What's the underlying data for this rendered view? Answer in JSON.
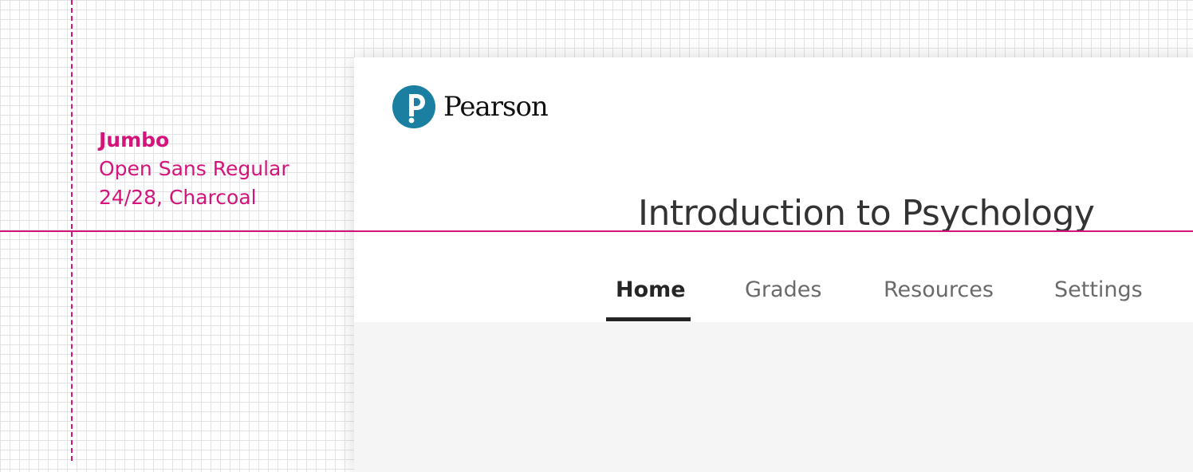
{
  "annotation": {
    "title": "Jumbo",
    "font_line": "Open Sans Regular",
    "spec_line": "24/28, Charcoal"
  },
  "brand": {
    "name": "Pearson",
    "logo_icon": "pearson-p-icon",
    "logo_color": "#1a7fa0"
  },
  "course": {
    "title": "Introduction to Psychology"
  },
  "tabs": [
    {
      "label": "Home",
      "active": true
    },
    {
      "label": "Grades",
      "active": false
    },
    {
      "label": "Resources",
      "active": false
    },
    {
      "label": "Settings",
      "active": false
    }
  ],
  "colors": {
    "guide": "#d4147a",
    "text": "#333333",
    "tab_inactive": "#6a6a6a",
    "content_bg": "#f5f5f5"
  }
}
